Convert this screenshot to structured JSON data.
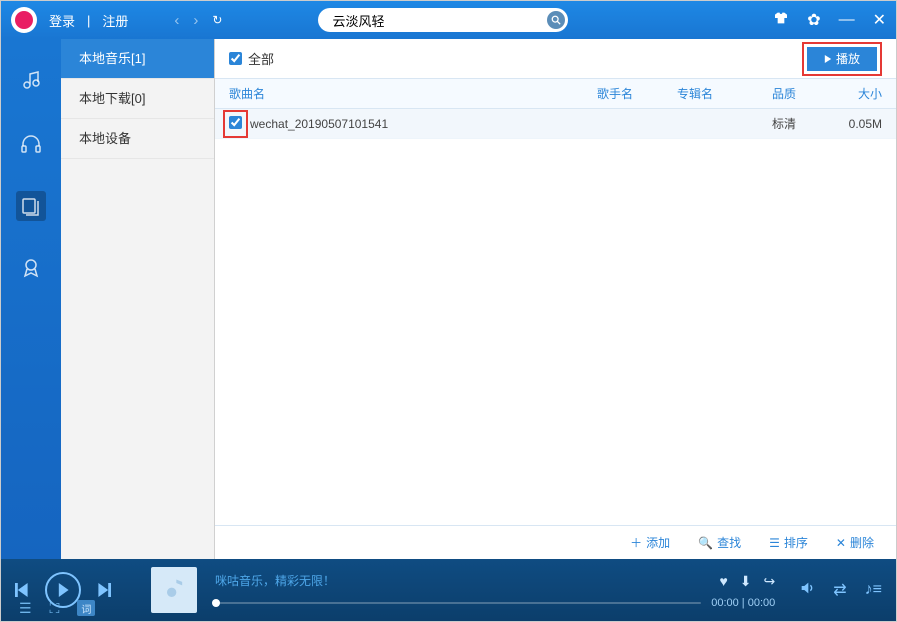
{
  "auth": {
    "login": "登录",
    "sep": "|",
    "register": "注册"
  },
  "search": {
    "value": "云淡风轻"
  },
  "sidebar": {
    "items": [
      {
        "label": "本地音乐[1]"
      },
      {
        "label": "本地下载[0]"
      },
      {
        "label": "本地设备"
      }
    ]
  },
  "content": {
    "select_all": "全部",
    "play_btn": "播放",
    "columns": {
      "name": "歌曲名",
      "artist": "歌手名",
      "album": "专辑名",
      "quality": "品质",
      "size": "大小"
    },
    "rows": [
      {
        "name": "wechat_20190507101541",
        "artist": "",
        "album": "",
        "quality": "标清",
        "size": "0.05M"
      }
    ],
    "footer": {
      "add": "添加",
      "find": "查找",
      "sort": "排序",
      "delete": "删除"
    }
  },
  "player": {
    "slogan": "咪咕音乐，精彩无限！",
    "time": "00:00 | 00:00",
    "lyric_btn": "词"
  }
}
